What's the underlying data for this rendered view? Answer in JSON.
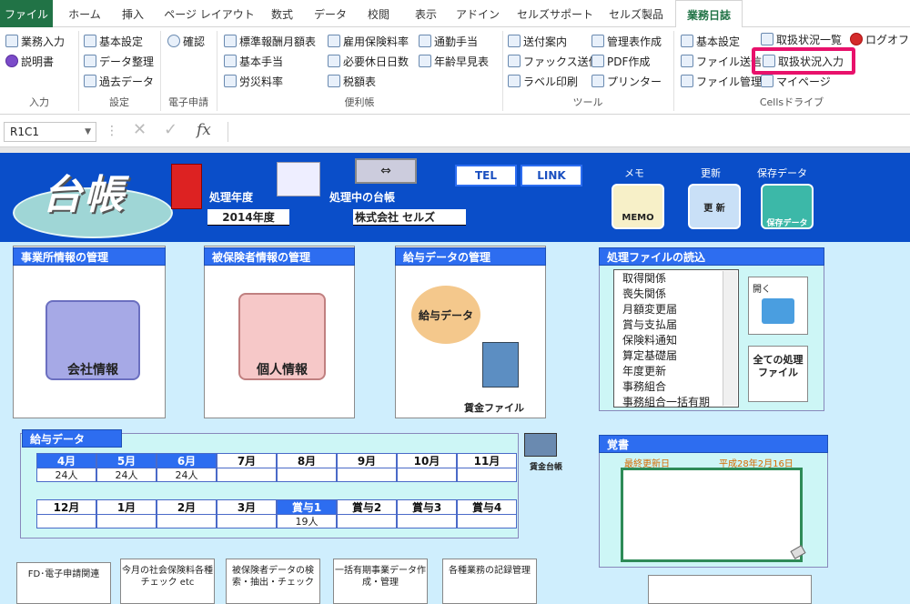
{
  "tabs": [
    "ファイル",
    "ホーム",
    "挿入",
    "ページ レイアウト",
    "数式",
    "データ",
    "校閲",
    "表示",
    "アドイン",
    "セルズサポート",
    "セルズ製品",
    "業務日誌"
  ],
  "ribbon": {
    "input": [
      "業務入力",
      "説明書"
    ],
    "settings": [
      "基本設定",
      "データ整理",
      "過去データ"
    ],
    "confirm": "確認",
    "convenience_col1": [
      "標準報酬月額表",
      "基本手当",
      "労災料率"
    ],
    "convenience_col2": [
      "雇用保険料率",
      "必要休日日数",
      "税額表"
    ],
    "convenience_col3": [
      "通勤手当",
      "年齢早見表"
    ],
    "tools_col1": [
      "送付案内",
      "ファックス送信",
      "ラベル印刷"
    ],
    "tools_col2": [
      "管理表作成",
      "PDF作成",
      "プリンター"
    ],
    "cells_col1": [
      "基本設定",
      "ファイル送信",
      "ファイル管理"
    ],
    "cells_col2": [
      "取扱状況一覧",
      "取扱状況入力",
      "マイページ"
    ],
    "logoff": "ログオフ",
    "groups": [
      "入力",
      "設定",
      "電子申請",
      "便利帳",
      "ツール",
      "Cellsドライブ"
    ]
  },
  "formula": {
    "namebox": "R1C1",
    "fx": "fx"
  },
  "sheet": {
    "logo": "台帳",
    "year_label": "処理年度",
    "year_value": "2014年度",
    "company_label": "処理中の台帳",
    "company_value": "株式会社 セルズ",
    "tel": "TEL",
    "link": "LINK",
    "memo_label": "メモ",
    "memo_btn": "MEMO",
    "update_label": "更新",
    "update_btn": "更 新",
    "save_label": "保存データ",
    "save_btn": "保存データ",
    "panel1_title": "事業所情報の管理",
    "panel1_btn": "会社情報",
    "panel2_title": "被保険者情報の管理",
    "panel2_btn": "個人情報",
    "panel3_title": "給与データの管理",
    "panel3_btn": "給与データ",
    "panel3_file": "賃金ファイル",
    "files_title": "処理ファイルの読込",
    "files": [
      "取得関係",
      "喪失関係",
      "月額変更届",
      "賞与支払届",
      "保険料通知",
      "算定基礎届",
      "年度更新",
      "事務組合",
      "事務組合一括有期"
    ],
    "open_btn": "開く",
    "all_files_btn": "全ての処理ファイル",
    "salary_title": "給与データ",
    "months1": [
      "4月",
      "5月",
      "6月",
      "7月",
      "8月",
      "9月",
      "10月",
      "11月"
    ],
    "counts1": [
      "24人",
      "24人",
      "24人",
      "",
      "",
      "",
      "",
      ""
    ],
    "months2": [
      "12月",
      "1月",
      "2月",
      "3月",
      "賞与1",
      "賞与2",
      "賞与3",
      "賞与4"
    ],
    "counts2": [
      "",
      "",
      "",
      "",
      "19人",
      "",
      "",
      ""
    ],
    "ledger_label": "賃金台帳",
    "notes_title": "覚書",
    "last_update_label": "最終更新日",
    "last_update_value": "平成28年2月16日",
    "bottom_btns": [
      "FD･電子申請関連",
      "今月の社会保険料各種チェック etc",
      "被保険者データの検索・抽出・チェック",
      "一括有期事業データ作成・管理",
      "各種業務の記録管理"
    ]
  }
}
